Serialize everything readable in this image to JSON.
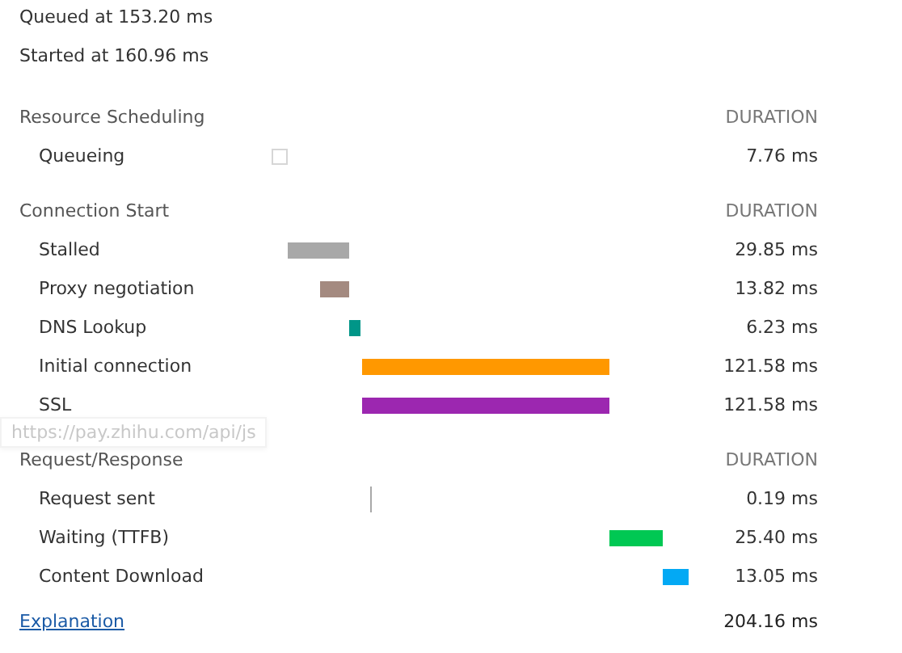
{
  "queued": "Queued at 153.20 ms",
  "started": "Started at 160.96 ms",
  "sections": [
    {
      "title": "Resource Scheduling",
      "duration_heading": "DURATION",
      "rows": [
        {
          "label": "Queueing",
          "kind": "hollow",
          "color": "#ffffff",
          "duration": "7.76 ms"
        }
      ]
    },
    {
      "title": "Connection Start",
      "duration_heading": "DURATION",
      "rows": [
        {
          "label": "Stalled",
          "kind": "solid",
          "color": "#a8a8a8",
          "duration": "29.85 ms"
        },
        {
          "label": "Proxy negotiation",
          "kind": "solid",
          "color": "#a48a80",
          "duration": "13.82 ms"
        },
        {
          "label": "DNS Lookup",
          "kind": "solid",
          "color": "#009688",
          "duration": "6.23 ms"
        },
        {
          "label": "Initial connection",
          "kind": "solid",
          "color": "#ff9800",
          "duration": "121.58 ms"
        },
        {
          "label": "SSL",
          "kind": "solid",
          "color": "#9c27b0",
          "duration": "121.58 ms"
        }
      ]
    },
    {
      "title": "Request/Response",
      "duration_heading": "DURATION",
      "rows": [
        {
          "label": "Request sent",
          "kind": "line",
          "color": "#a8a8a8",
          "duration": "0.19 ms"
        },
        {
          "label": "Waiting (TTFB)",
          "kind": "solid",
          "color": "#00c853",
          "duration": "25.40 ms"
        },
        {
          "label": "Content Download",
          "kind": "solid",
          "color": "#03a9f4",
          "duration": "13.05 ms"
        }
      ]
    }
  ],
  "tooltip": "https://pay.zhihu.com/api/js",
  "footer": {
    "link": "Explanation",
    "total": "204.16 ms"
  }
}
